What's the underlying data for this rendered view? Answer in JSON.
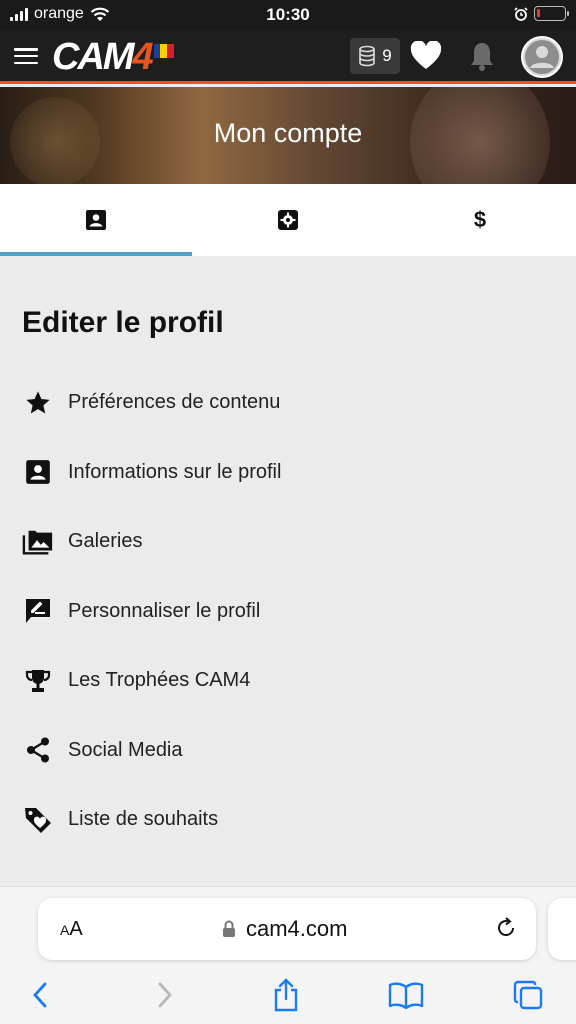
{
  "status_bar": {
    "carrier": "orange",
    "time": "10:30"
  },
  "header": {
    "logo_text_main": "CAM",
    "logo_text_accent": "4",
    "coins_count": "9",
    "accent_color": "#e8561f"
  },
  "banner": {
    "title": "Mon compte"
  },
  "tabs": [
    {
      "name": "profile",
      "icon": "profile-card-icon",
      "active": true
    },
    {
      "name": "settings",
      "icon": "gear-icon",
      "active": false
    },
    {
      "name": "payments",
      "icon": "dollar-icon",
      "label": "$",
      "active": false
    }
  ],
  "section": {
    "title": "Editer le profil",
    "items": [
      {
        "label": "Préférences de contenu",
        "icon": "star-icon"
      },
      {
        "label": "Informations sur le profil",
        "icon": "profile-card-icon"
      },
      {
        "label": "Galeries",
        "icon": "gallery-icon"
      },
      {
        "label": "Personnaliser le profil",
        "icon": "edit-signature-icon"
      },
      {
        "label": "Les Trophées CAM4",
        "icon": "trophy-icon"
      },
      {
        "label": "Social Media",
        "icon": "share-icon"
      },
      {
        "label": "Liste de souhaits",
        "icon": "tag-heart-icon"
      }
    ]
  },
  "browser": {
    "text_size_label_small": "A",
    "text_size_label_large": "A",
    "domain": "cam4.com",
    "link_color": "#1a7cf5"
  }
}
